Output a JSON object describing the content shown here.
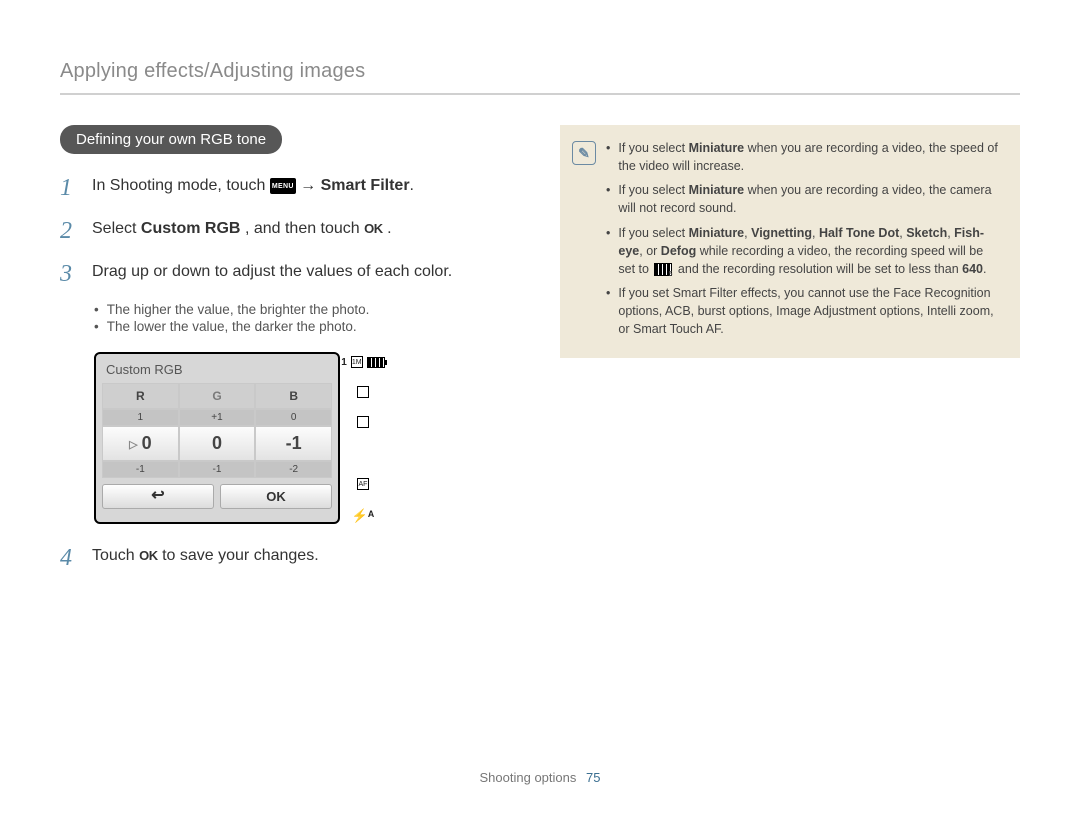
{
  "header": {
    "title": "Applying effects/Adjusting images"
  },
  "pill": {
    "text": "Defining your own RGB tone"
  },
  "steps": {
    "s1": {
      "num": "1",
      "pre": "In Shooting mode, touch ",
      "menu_chip": "MENU",
      "arrow": "→",
      "post_bold": "Smart Filter",
      "period": "."
    },
    "s2": {
      "num": "2",
      "pre": "Select ",
      "bold": "Custom RGB",
      "mid": ", and then touch ",
      "ok": "OK",
      "period": "."
    },
    "s3": {
      "num": "3",
      "text": "Drag up or down to adjust the values of each color.",
      "sub1": "The higher the value, the brighter the photo.",
      "sub2": "The lower the value, the darker the photo."
    },
    "s4": {
      "num": "4",
      "pre": "Touch ",
      "ok": "OK",
      "post": " to save your changes."
    }
  },
  "cam": {
    "title": "Custom RGB",
    "head": {
      "r": "R",
      "g": "G",
      "b": "B"
    },
    "row_small_top": {
      "r": "1",
      "g": "+1",
      "b": "0"
    },
    "row_main": {
      "r": "0",
      "g": "0",
      "b": "-1"
    },
    "row_small_bot": {
      "r": "-1",
      "g": "-1",
      "b": "-2"
    },
    "back": "↩",
    "ok": "OK",
    "side": {
      "one": "1",
      "sq_label": "1M",
      "af_label": "AF"
    }
  },
  "note": {
    "icon": "✎",
    "items": {
      "n1": {
        "pre": "If you select ",
        "b1": "Miniature",
        "post": " when you are recording a video, the speed of the video will increase."
      },
      "n2": {
        "pre": "If you select ",
        "b1": "Miniature",
        "post": " when you are recording a video, the camera will not record sound."
      },
      "n3": {
        "pre": "If you select ",
        "b1": "Miniature",
        "c1": ", ",
        "b2": "Vignetting",
        "c2": ", ",
        "b3": "Half Tone Dot",
        "c3": ", ",
        "b4": "Sketch",
        "c4": ", ",
        "b5": "Fish-eye",
        "c5": ", or ",
        "b6": "Defog",
        "mid": " while recording a video, the recording speed will be set to ",
        "tail": " and the recording resolution will be set to less than ",
        "b7": "640",
        "period": "."
      },
      "n4": {
        "text": "If you set Smart Filter effects, you cannot use the Face Recognition options, ACB, burst options, Image Adjustment options, Intelli zoom, or Smart Touch AF."
      }
    }
  },
  "footer": {
    "section": "Shooting options",
    "page": "75"
  }
}
